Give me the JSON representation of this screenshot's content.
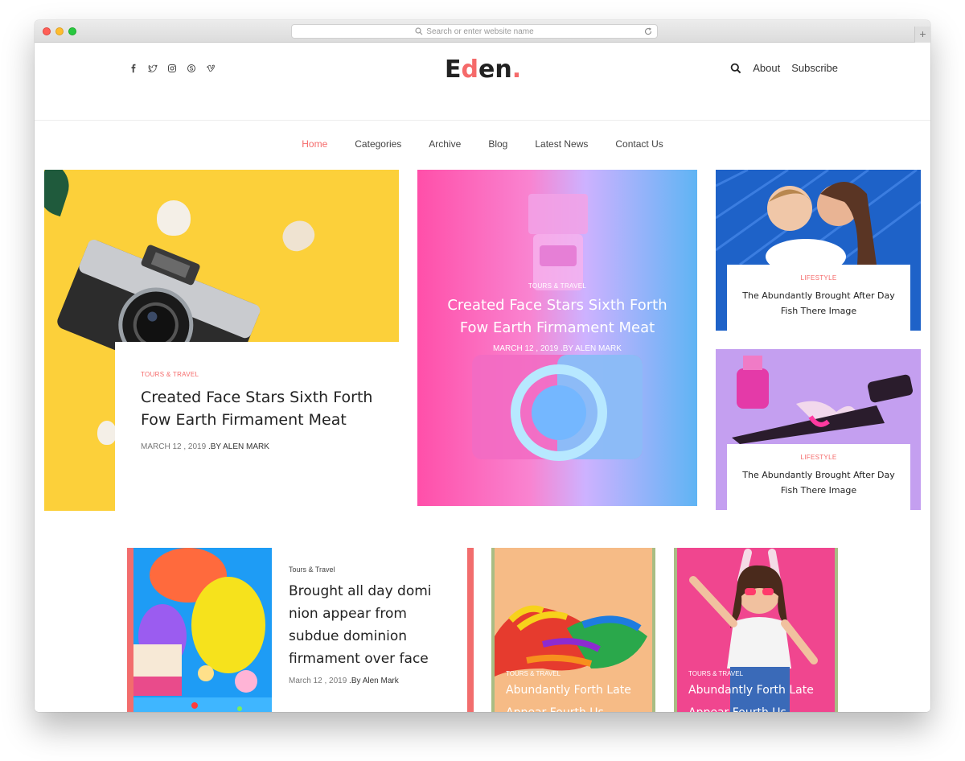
{
  "browser": {
    "url_placeholder": "Search or enter website name",
    "new_tab_label": "+"
  },
  "header": {
    "logo_part1": "E",
    "logo_part2": "d",
    "logo_part3": "en",
    "logo_dot": ".",
    "social_icons": [
      "facebook-icon",
      "twitter-icon",
      "instagram-icon",
      "skype-icon",
      "vimeo-icon"
    ],
    "links": {
      "about": "About",
      "subscribe": "Subscribe"
    }
  },
  "nav": {
    "items": [
      "Home",
      "Categories",
      "Archive",
      "Blog",
      "Latest News",
      "Contact Us"
    ],
    "active": "Home"
  },
  "featured": {
    "main": {
      "tag": "TOURS & TRAVEL",
      "title": "Created Face Stars Sixth Forth Fow Earth Firmament Meat",
      "date": "MARCH 12 , 2019",
      "author": ".BY ALEN MARK"
    },
    "center": {
      "tag": "TOURS & TRAVEL",
      "title": "Created Face Stars Sixth Forth Fow Earth Firmament Meat",
      "meta": "MARCH 12 , 2019 .BY ALEN MARK"
    },
    "side": [
      {
        "tag": "LIFESTYLE",
        "title": "The Abundantly Brought After Day Fish There Image"
      },
      {
        "tag": "LIFESTYLE",
        "title": "The Abundantly Brought After Day Fish There Image"
      }
    ]
  },
  "row2": {
    "post": {
      "tag": "Tours & Travel",
      "title": "Brought all day domi nion appear from subdue dominion firmament over face",
      "date": "March 12 , 2019",
      "author": ".By Alen Mark"
    },
    "tiles": [
      {
        "tag": "TOURS & TRAVEL",
        "title": "Abundantly Forth Late Appear Fourth Us."
      },
      {
        "tag": "TOURS & TRAVEL",
        "title": "Abundantly Forth Late Appear Fourth Us."
      }
    ]
  },
  "colors": {
    "accent": "#f56a6a",
    "yellow_bg": "#fcd03a",
    "blue_bg": "#1e62c8",
    "lilac_bg": "#c49ff0",
    "pink_bg": "#f0468f",
    "peach_bg": "#f6bb86"
  }
}
